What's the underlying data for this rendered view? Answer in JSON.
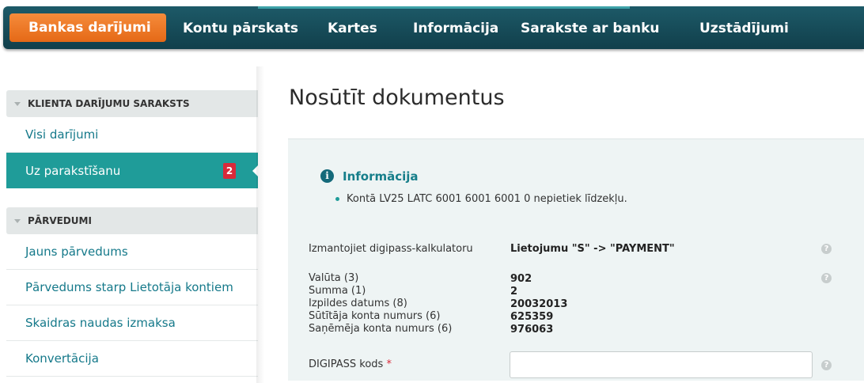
{
  "nav": {
    "active": "Bankas darījumi",
    "items": [
      "Kontu pārskats",
      "Kartes",
      "Informācija",
      "Sarakste ar banku",
      "Uzstādījumi"
    ]
  },
  "sidebar": {
    "sections": [
      {
        "title": "KLIENTA DARĪJUMU SARAKSTS",
        "items": [
          {
            "label": "Visi darījumi"
          },
          {
            "label": "Uz parakstīšanu",
            "badge": "2"
          }
        ]
      },
      {
        "title": "PĀRVEDUMI",
        "items": [
          {
            "label": "Jauns pārvedums"
          },
          {
            "label": "Pārvedums starp Lietotāja kontiem"
          },
          {
            "label": "Skaidras naudas izmaksa"
          },
          {
            "label": "Konvertācija"
          }
        ]
      }
    ]
  },
  "page": {
    "title": "Nosūtīt dokumentus",
    "info_icon": "info-icon",
    "info_title": "Informācija",
    "info_message": "Kontā LV25 LATC 6001 6001 6001 0 nepietiek līdzekļu."
  },
  "form": {
    "digipass_label": "Izmantojiet digipass-kalkulatoru",
    "digipass_mode": "Lietojumu \"S\" -> \"PAYMENT\"",
    "fields": [
      {
        "label": "Valūta (3)",
        "value": "902"
      },
      {
        "label": "Summa (1)",
        "value": "2"
      },
      {
        "label": "Izpildes datums (8)",
        "value": "20032013"
      },
      {
        "label": "Sūtītāja konta numurs (6)",
        "value": "625359"
      },
      {
        "label": "Saņēmēja konta numurs (6)",
        "value": "976063"
      }
    ],
    "code_label": "DIGIPASS kods",
    "required_mark": "*",
    "code_value": "",
    "help_symbol": "?"
  },
  "colors": {
    "nav_bg": "#14495a",
    "active_tab": "#ee7a28",
    "accent": "#1f9c99",
    "badge": "#d92a3a"
  }
}
